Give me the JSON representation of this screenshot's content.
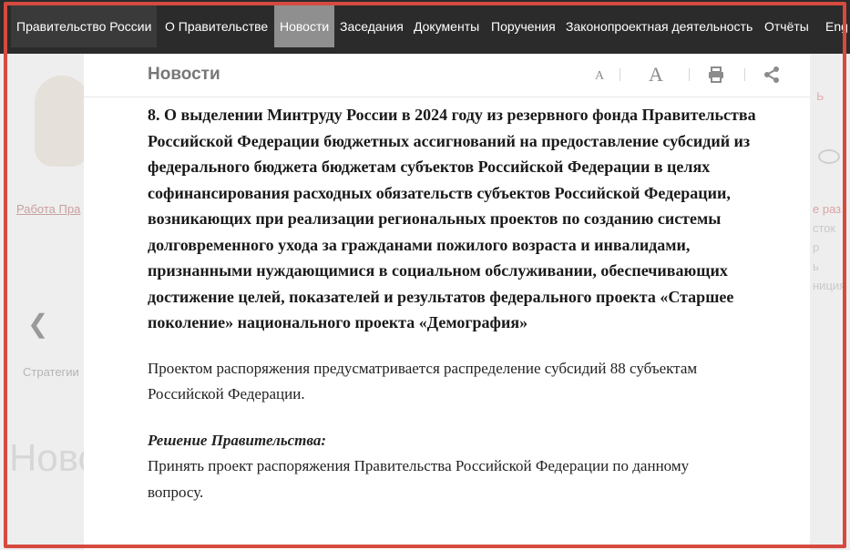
{
  "topnav": {
    "items": [
      {
        "label": "Правительство России"
      },
      {
        "label": "О Правительстве"
      },
      {
        "label": "Новости"
      },
      {
        "label": "Заседания"
      },
      {
        "label": "Документы"
      },
      {
        "label": "Поручения"
      },
      {
        "label": "Законопроектная деятельность"
      },
      {
        "label": "Отчёты"
      },
      {
        "label": "Eng"
      }
    ],
    "active": "Новости"
  },
  "background": {
    "link": "Работа Пра",
    "strategy_text": "Стратегии",
    "big_title": "Ново",
    "right_fragments": [
      "е раз",
      "сток",
      "р",
      "ь",
      "ниция"
    ],
    "red_fragment": "ь"
  },
  "modal": {
    "title": "Новости",
    "font_small": "A",
    "font_large": "A",
    "heading": "8. О выделении Минтруду России в 2024 году из резервного фонда Правительства Российской Федерации бюджетных ассигнований на предоставление субсидий из федерального бюджета бюджетам субъектов Российской Федерации в целях софинансирования расходных обязательств субъектов Российской Федерации, возникающих при реализации региональных проектов по созданию системы долговременного ухода за гражданами пожилого возраста и инвалидами, признанными нуждающимися в социальном обслуживании, обеспечивающих достижение целей, показателей и результатов федерального проекта «Старшее поколение» национального проекта «Демография»",
    "paragraph": "Проектом распоряжения предусматривается распределение субсидий 88 субъектам Российской Федерации.",
    "decision_title": "Решение Правительства:",
    "decision_text": "Принять проект распоряжения Правительства Российской Федерации по данному вопросу."
  },
  "colors": {
    "nav_bg": "#2b2b2b",
    "nav_active": "#8f8f8f",
    "frame": "#d64a3f"
  }
}
